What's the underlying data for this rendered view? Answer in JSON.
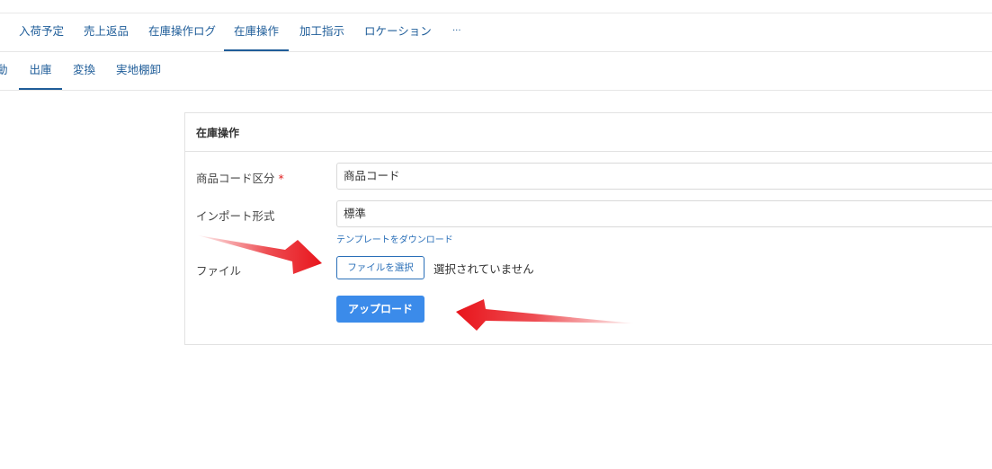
{
  "tabs_main": [
    {
      "label": "入荷予定"
    },
    {
      "label": "売上返品"
    },
    {
      "label": "在庫操作ログ"
    },
    {
      "label": "在庫操作",
      "active": true
    },
    {
      "label": "加工指示"
    },
    {
      "label": "ロケーション"
    },
    {
      "label": "···"
    }
  ],
  "tabs_sub": [
    {
      "label": "動"
    },
    {
      "label": "出庫",
      "active": true
    },
    {
      "label": "変換"
    },
    {
      "label": "実地棚卸"
    }
  ],
  "form": {
    "title": "在庫操作",
    "product_code_label": "商品コード区分",
    "required_mark": "*",
    "product_code_value": "商品コード",
    "import_format_label": "インポート形式",
    "import_format_value": "標準",
    "template_link": "テンプレートをダウンロード",
    "file_label": "ファイル",
    "file_button": "ファイルを選択",
    "file_status": "選択されていません",
    "upload_button": "アップロード"
  },
  "colors": {
    "tab_text": "#1f5d99",
    "primary": "#3b8bea",
    "annotation_arrow": "#e8131a"
  }
}
